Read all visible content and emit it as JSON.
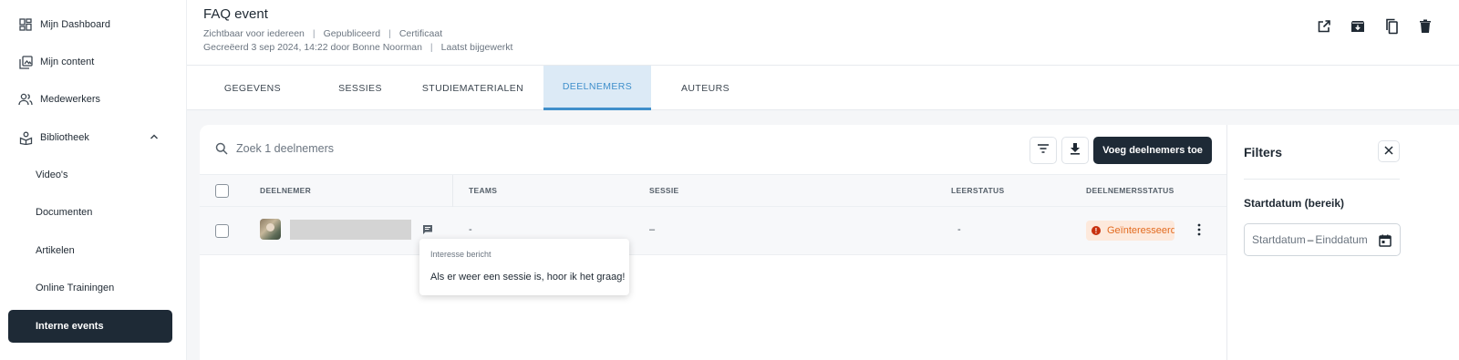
{
  "sidebar": {
    "items": [
      {
        "label": "Mijn Dashboard",
        "icon": "dashboard-icon"
      },
      {
        "label": "Mijn content",
        "icon": "library-icon"
      },
      {
        "label": "Medewerkers",
        "icon": "people-icon"
      },
      {
        "label": "Bibliotheek",
        "icon": "book-hand-icon",
        "expanded": true
      }
    ],
    "subitems": [
      {
        "label": "Video's"
      },
      {
        "label": "Documenten"
      },
      {
        "label": "Artikelen"
      },
      {
        "label": "Online Trainingen"
      },
      {
        "label": "Interne events",
        "active": true
      }
    ]
  },
  "header": {
    "title": "FAQ event",
    "meta_line1": [
      "Zichtbaar voor iedereen",
      "Gepubliceerd",
      "Certificaat"
    ],
    "meta_line2": [
      "Gecreëerd 3 sep 2024, 14:22 door Bonne Noorman",
      "Laatst bijgewerkt"
    ],
    "actions": [
      "open-external-icon",
      "archive-icon",
      "copy-icon",
      "delete-icon"
    ]
  },
  "tabs": [
    {
      "label": "GEGEVENS"
    },
    {
      "label": "SESSIES"
    },
    {
      "label": "STUDIEMATERIALEN"
    },
    {
      "label": "DEELNEMERS",
      "active": true
    },
    {
      "label": "AUTEURS"
    }
  ],
  "toolbar": {
    "search_placeholder": "Zoek 1 deelnemers",
    "add_button": "Voeg deelnemers toe"
  },
  "table": {
    "columns": [
      "DEELNEMER",
      "TEAMS",
      "SESSIE",
      "LEERSTATUS",
      "DEELNEMERSSTATUS"
    ],
    "rows": [
      {
        "teams": "-",
        "sessie": "–",
        "leerstatus": "-",
        "status": "Geïnteresseerd"
      }
    ]
  },
  "tooltip": {
    "heading": "Interesse bericht",
    "message": "Als er weer een sessie is, hoor ik het graag!"
  },
  "filters": {
    "title": "Filters",
    "date_label": "Startdatum (bereik)",
    "start_placeholder": "Startdatum",
    "end_placeholder": "Einddatum"
  },
  "colors": {
    "accent": "#3f8fcb",
    "dark": "#1e2a36",
    "status_orange": "#e26a1f"
  }
}
